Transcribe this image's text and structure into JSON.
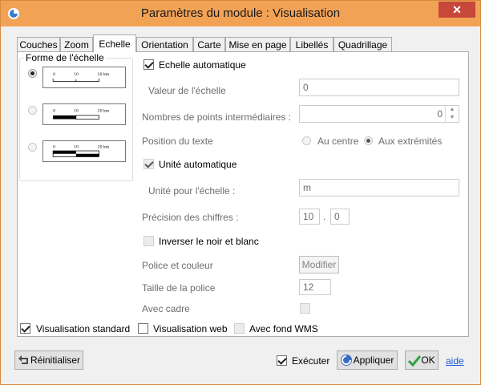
{
  "window": {
    "title": "Paramètres du module : Visualisation",
    "close_glyph": "✕"
  },
  "tabs": [
    "Couches",
    "Zoom",
    "Echelle",
    "Orientation",
    "Carte",
    "Mise en page",
    "Libellés",
    "Quadrillage"
  ],
  "active_tab": "Echelle",
  "scale_shape": {
    "title": "Forme de l'échelle",
    "options": [
      {
        "ticks": [
          "0",
          "10",
          "20 km"
        ],
        "checked": true,
        "enabled": true
      },
      {
        "ticks": [
          "0",
          "10",
          "20 km"
        ],
        "checked": false,
        "enabled": false
      },
      {
        "ticks": [
          "0",
          "10",
          "20 km"
        ],
        "checked": false,
        "enabled": false
      }
    ]
  },
  "auto_scale": {
    "label": "Echelle automatique",
    "checked": true
  },
  "scale_value": {
    "label": "Valeur de l'échelle",
    "value": "0"
  },
  "intermediate_points": {
    "label": "Nombres de points intermédiaires :",
    "value": "0",
    "up": "▲",
    "down": "▼"
  },
  "text_position": {
    "label": "Position du texte",
    "options": [
      "Au centre",
      "Aux extrémités"
    ],
    "selected": "Aux extrémités"
  },
  "auto_unit": {
    "label": "Unité automatique",
    "checked": true
  },
  "unit": {
    "label": "Unité pour l'échelle :",
    "value": "m"
  },
  "precision": {
    "label": "Précision des chiffres :",
    "int": "10",
    "sep": ".",
    "dec": "0"
  },
  "invert": {
    "label": "Inverser le noir et blanc",
    "checked": false
  },
  "font": {
    "label": "Police et couleur",
    "button": "Modifier"
  },
  "font_size": {
    "label": "Taille de la police",
    "value": "12"
  },
  "frame": {
    "label": "Avec cadre",
    "checked": false
  },
  "bottom_options": [
    {
      "label": "Visualisation standard",
      "checked": true,
      "enabled": true
    },
    {
      "label": "Visualisation web",
      "checked": false,
      "enabled": true
    },
    {
      "label": "Avec fond WMS",
      "checked": false,
      "enabled": false
    }
  ],
  "footer": {
    "reset": "Réinitialiser",
    "execute": "Exécuter",
    "execute_checked": true,
    "apply": "Appliquer",
    "ok": "OK",
    "help": "aide"
  },
  "colors": {
    "titlebar": "#f2a255",
    "close": "#c7473a",
    "link": "#1a5ad7"
  }
}
